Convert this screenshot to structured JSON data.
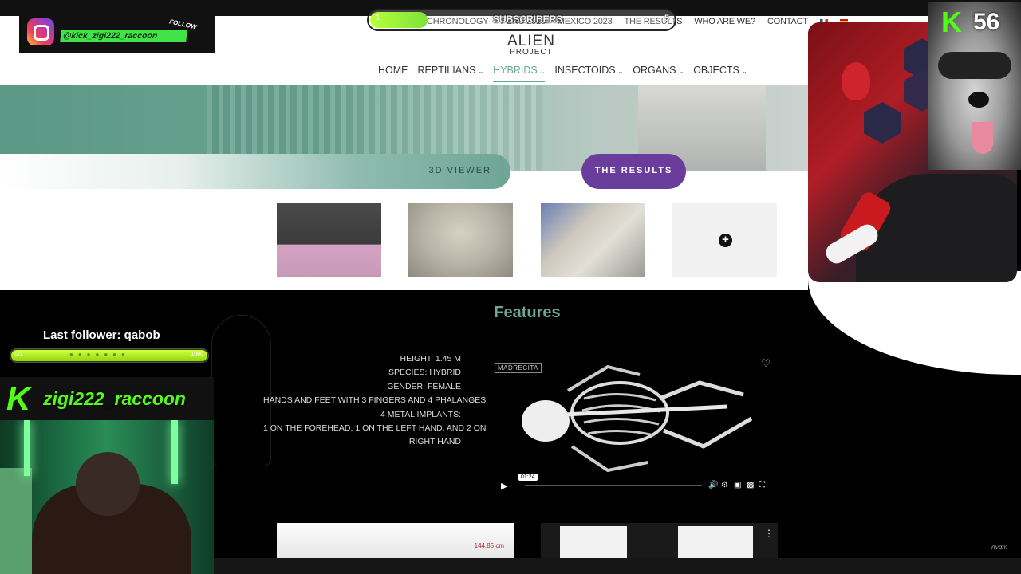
{
  "overlay": {
    "subscribers": {
      "label": "SUBSCRIBERS",
      "current": "1",
      "goal": "5"
    },
    "instagram": {
      "handle": "@kick_zigi222_raccoon",
      "follow": "FOLLOW"
    },
    "kick_badge": {
      "letter": "K",
      "count": "56"
    },
    "last_follower": "Last follower: qabob",
    "follower_goal": {
      "min": "0/1",
      "max": "1000"
    },
    "channel_name": "zigi222_raccoon",
    "watermark": "rtvdm"
  },
  "topnav": {
    "links": [
      "CHRONOLOGY",
      "PERU 2018",
      "MEXICO 2023",
      "THE RESULTS",
      "WHO ARE WE?",
      "CONTACT"
    ],
    "flags": [
      "flag-fr-icon",
      "flag-es-icon"
    ]
  },
  "site": {
    "logo_line1": "ALIEN",
    "logo_line2": "PROJECT",
    "nav": [
      {
        "label": "HOME",
        "dropdown": false
      },
      {
        "label": "REPTILIANS",
        "dropdown": true
      },
      {
        "label": "HYBRIDS",
        "dropdown": true,
        "active": true
      },
      {
        "label": "INSECTOIDS",
        "dropdown": true
      },
      {
        "label": "ORGANS",
        "dropdown": true
      },
      {
        "label": "OBJECTS",
        "dropdown": true
      }
    ],
    "viewer_button": "3D VIEWER",
    "results_button": "THE RESULTS",
    "features_title": "Features",
    "specs": [
      "HEIGHT: 1.45 M",
      "SPECIES: HYBRID",
      "GENDER: FEMALE",
      "HANDS AND FEET WITH 3 FINGERS AND 4 PHALANGES",
      "4 METAL IMPLANTS:",
      "1 ON THE FOREHEAD, 1 ON THE LEFT HAND, AND 2 ON THE",
      "RIGHT HAND"
    ],
    "video": {
      "tag": "MADRECITA",
      "time": "01:24"
    },
    "measure_label": "144.85 cm"
  },
  "colors": {
    "accent_green": "#6aa896",
    "results_purple": "#6a3c9c",
    "kick_green": "#53fc18"
  }
}
